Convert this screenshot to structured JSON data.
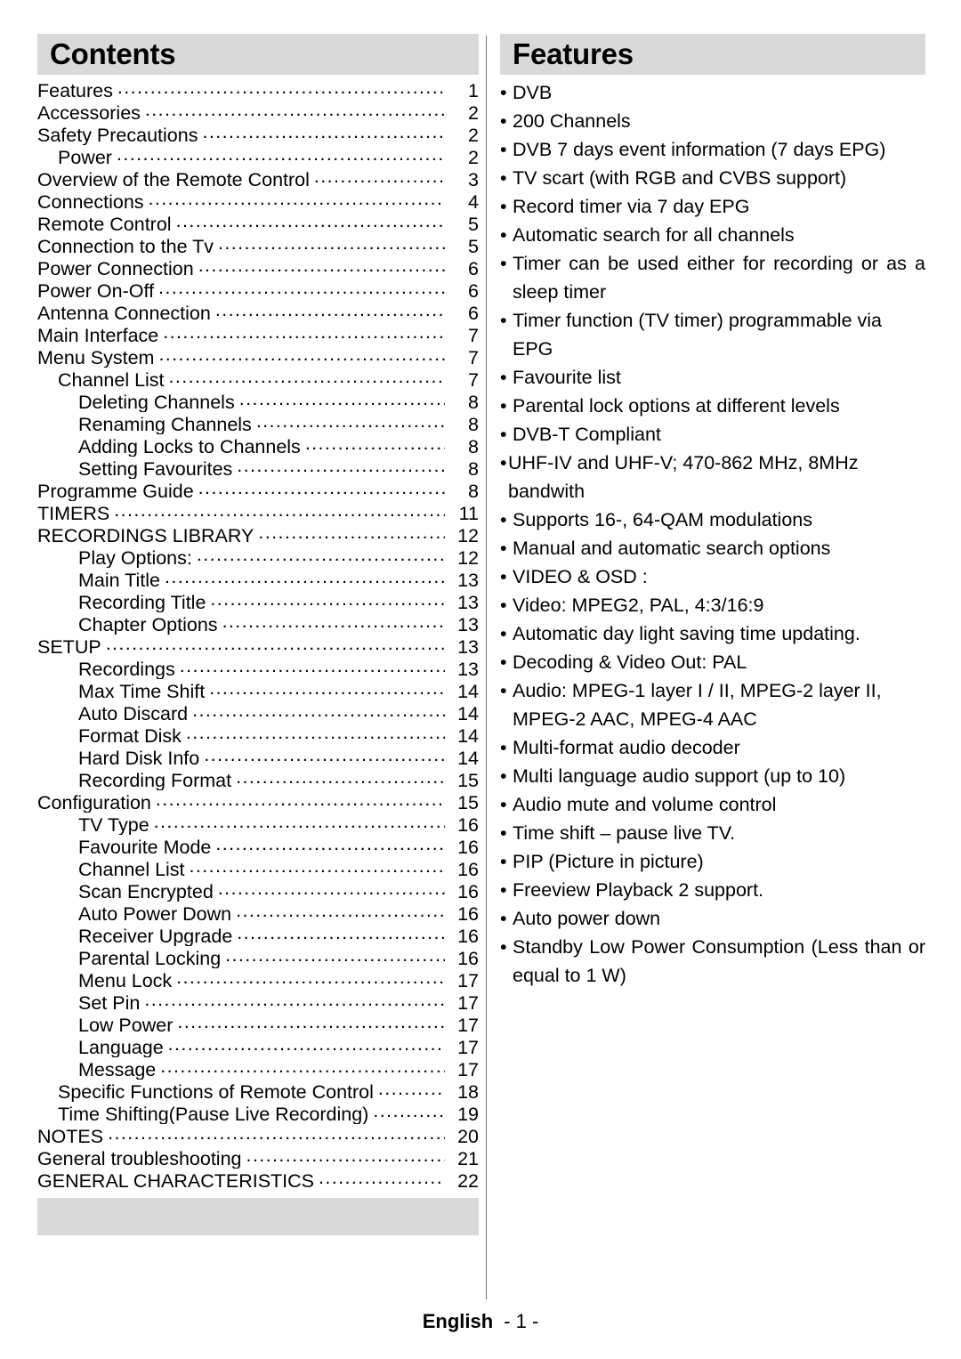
{
  "footer": {
    "language": "English",
    "page_number": "- 1 -"
  },
  "contents": {
    "heading": "Contents",
    "entries": [
      {
        "label": "Features",
        "page": "1",
        "level": 0
      },
      {
        "label": "Accessories",
        "page": "2",
        "level": 0
      },
      {
        "label": "Safety Precautions",
        "page": "2",
        "level": 0
      },
      {
        "label": "Power",
        "page": "2",
        "level": 1
      },
      {
        "label": "Overview of the Remote Control",
        "page": "3",
        "level": 0
      },
      {
        "label": "Connections",
        "page": "4",
        "level": 0
      },
      {
        "label": "Remote Control",
        "page": "5",
        "level": 0
      },
      {
        "label": "Connection to the Tv",
        "page": "5",
        "level": 0
      },
      {
        "label": "Power Connection",
        "page": "6",
        "level": 0
      },
      {
        "label": "Power On-Off",
        "page": "6",
        "level": 0
      },
      {
        "label": "Antenna Connection",
        "page": "6",
        "level": 0
      },
      {
        "label": "Main Interface",
        "page": "7",
        "level": 0
      },
      {
        "label": "Menu System",
        "page": "7",
        "level": 0
      },
      {
        "label": "Channel List",
        "page": "7",
        "level": 1
      },
      {
        "label": "Deleting Channels",
        "page": "8",
        "level": 2
      },
      {
        "label": "Renaming Channels",
        "page": "8",
        "level": 2
      },
      {
        "label": "Adding Locks to Channels",
        "page": "8",
        "level": 2
      },
      {
        "label": "Setting Favourites",
        "page": "8",
        "level": 2
      },
      {
        "label": "Programme Guide",
        "page": "8",
        "level": 0
      },
      {
        "label": "TIMERS",
        "page": "11",
        "level": 0
      },
      {
        "label": "RECORDINGS LIBRARY",
        "page": "12",
        "level": 0
      },
      {
        "label": "Play Options:",
        "page": "12",
        "level": 2
      },
      {
        "label": "Main Title",
        "page": "13",
        "level": 2
      },
      {
        "label": "Recording Title",
        "page": "13",
        "level": 2
      },
      {
        "label": "Chapter Options",
        "page": "13",
        "level": 2
      },
      {
        "label": "SETUP",
        "page": "13",
        "level": 0
      },
      {
        "label": "Recordings",
        "page": "13",
        "level": 2
      },
      {
        "label": "Max Time Shift",
        "page": "14",
        "level": 2
      },
      {
        "label": "Auto Discard",
        "page": "14",
        "level": 2
      },
      {
        "label": "Format Disk",
        "page": "14",
        "level": 2
      },
      {
        "label": "Hard Disk Info",
        "page": "14",
        "level": 2
      },
      {
        "label": "Recording Format",
        "page": "15",
        "level": 2
      },
      {
        "label": "Configuration",
        "page": "15",
        "level": 0
      },
      {
        "label": "TV Type",
        "page": "16",
        "level": 2
      },
      {
        "label": "Favourite Mode",
        "page": "16",
        "level": 2
      },
      {
        "label": "Channel List",
        "page": "16",
        "level": 2
      },
      {
        "label": "Scan Encrypted",
        "page": "16",
        "level": 2
      },
      {
        "label": "Auto Power Down",
        "page": "16",
        "level": 2
      },
      {
        "label": "Receiver Upgrade",
        "page": "16",
        "level": 2
      },
      {
        "label": "Parental Locking",
        "page": "16",
        "level": 2
      },
      {
        "label": "Menu Lock",
        "page": "17",
        "level": 2
      },
      {
        "label": "Set Pin",
        "page": "17",
        "level": 2
      },
      {
        "label": "Low Power",
        "page": "17",
        "level": 2
      },
      {
        "label": "Language",
        "page": "17",
        "level": 2
      },
      {
        "label": "Message",
        "page": "17",
        "level": 2
      },
      {
        "label": "Specific Functions of Remote Control",
        "page": "18",
        "level": 1
      },
      {
        "label": "Time Shifting(Pause Live Recording)",
        "page": "19",
        "level": 1
      },
      {
        "label": "NOTES",
        "page": "20",
        "level": 0
      },
      {
        "label": "General troubleshooting",
        "page": "21",
        "level": 0
      },
      {
        "label": "GENERAL CHARACTERISTICS",
        "page": "22",
        "level": 0
      }
    ]
  },
  "features": {
    "heading": "Features",
    "bullet_glyph": "•",
    "items": [
      {
        "text": "DVB",
        "justify": false,
        "gap": true
      },
      {
        "text": "200 Channels",
        "justify": false,
        "gap": true
      },
      {
        "text": "DVB 7 days event information (7 days EPG)",
        "justify": false,
        "gap": true
      },
      {
        "text": "TV scart (with RGB and CVBS support)",
        "justify": false,
        "gap": true
      },
      {
        "text": "Record timer via 7 day EPG",
        "justify": false,
        "gap": true
      },
      {
        "text": "Automatic search for all channels",
        "justify": false,
        "gap": true
      },
      {
        "text": "Timer can be used either for recording or as a sleep timer",
        "justify": true,
        "gap": true
      },
      {
        "text": "Timer function (TV timer) programmable via EPG",
        "justify": false,
        "gap": true
      },
      {
        "text": "Favourite list",
        "justify": false,
        "gap": true
      },
      {
        "text": "Parental lock options at different levels",
        "justify": false,
        "gap": true
      },
      {
        "text": "DVB-T Compliant",
        "justify": false,
        "gap": true
      },
      {
        "text": "UHF-IV and UHF-V; 470-862 MHz, 8MHz bandwith",
        "justify": false,
        "gap": false
      },
      {
        "text": "Supports 16-, 64-QAM modulations",
        "justify": false,
        "gap": true
      },
      {
        "text": "Manual and automatic search options",
        "justify": false,
        "gap": true
      },
      {
        "text": "VIDEO & OSD :",
        "justify": false,
        "gap": true
      },
      {
        "text": "Video: MPEG2, PAL, 4:3/16:9",
        "justify": false,
        "gap": true
      },
      {
        "text": "Automatic day light saving time updating.",
        "justify": false,
        "gap": true
      },
      {
        "text": "Decoding & Video Out: PAL",
        "justify": false,
        "gap": true
      },
      {
        "text": "Audio: MPEG-1 layer I / II, MPEG-2 layer II, MPEG-2 AAC, MPEG-4 AAC",
        "justify": false,
        "gap": true
      },
      {
        "text": "Multi-format audio decoder",
        "justify": false,
        "gap": true
      },
      {
        "text": "Multi language audio support (up to 10)",
        "justify": false,
        "gap": true
      },
      {
        "text": "Audio mute and volume control",
        "justify": false,
        "gap": true
      },
      {
        "text": "Time shift – pause live TV.",
        "justify": false,
        "gap": true
      },
      {
        "text": "PIP (Picture in picture)",
        "justify": false,
        "gap": true
      },
      {
        "text": "Freeview Playback 2 support.",
        "justify": false,
        "gap": true
      },
      {
        "text": "Auto power down",
        "justify": false,
        "gap": true
      },
      {
        "text": "Standby Low Power Consumption (Less than or equal to 1 W)",
        "justify": true,
        "gap": true
      }
    ]
  }
}
